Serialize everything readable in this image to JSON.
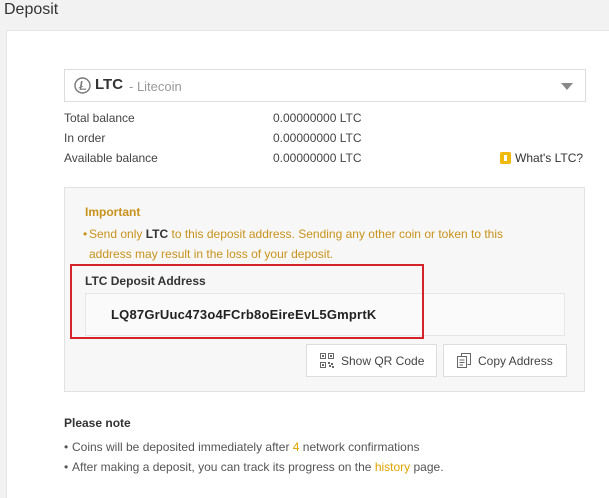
{
  "page": {
    "title": "Deposit"
  },
  "coin_select": {
    "code": "LTC",
    "name": "- Litecoin",
    "icon": "litecoin-icon"
  },
  "balances": [
    {
      "label": "Total balance",
      "value": "0.00000000 LTC"
    },
    {
      "label": "In order",
      "value": "0.00000000 LTC"
    },
    {
      "label": "Available balance",
      "value": "0.00000000 LTC"
    }
  ],
  "whats_link": {
    "label": "What's LTC?",
    "icon": "info-bulb-icon"
  },
  "important": {
    "title": "Important",
    "bullet": "•",
    "text_before": "Send only ",
    "coin": "LTC",
    "text_after": " to this deposit address. Sending any other coin or token to this address may result in the loss of your deposit."
  },
  "deposit": {
    "label": "LTC Deposit Address",
    "address": "LQ87GrUuc473o4FCrb8oEireEvL5GmprtK"
  },
  "buttons": {
    "qr_label": "Show QR Code",
    "copy_label": "Copy Address"
  },
  "note": {
    "title": "Please note",
    "item1_before": "Coins will be deposited immediately after ",
    "item1_count": "4",
    "item1_after": " network confirmations",
    "item2_before": "After making a deposit, you can track its progress on the ",
    "item2_link": "history",
    "item2_after": " page."
  },
  "colors": {
    "accent": "#e0a300",
    "highlight_border": "#d6232a",
    "important_text": "#c9921a"
  }
}
